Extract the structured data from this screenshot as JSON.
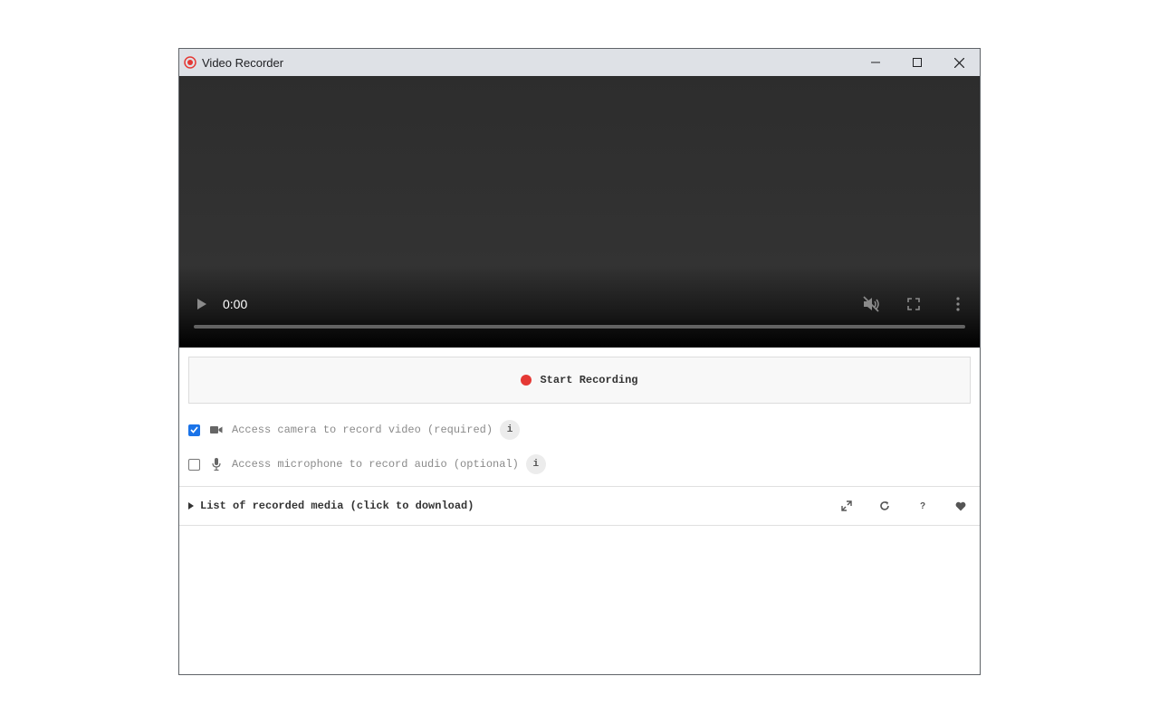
{
  "window": {
    "title": "Video Recorder",
    "controls": [
      "minimize",
      "maximize",
      "close"
    ]
  },
  "player": {
    "current_time": "0:00",
    "muted": true,
    "progress": 0
  },
  "recorder": {
    "start_label": "Start Recording",
    "record_color": "#e53935"
  },
  "options": {
    "camera": {
      "label": "Access camera to record video (required)",
      "checked": true,
      "info": "i",
      "icon": "video-camera-icon"
    },
    "microphone": {
      "label": "Access microphone to record audio (optional)",
      "checked": false,
      "info": "i",
      "icon": "microphone-icon"
    }
  },
  "media_list": {
    "label": "List of recorded media (click to download)",
    "tools": [
      "expand-icon",
      "refresh-icon",
      "help-icon",
      "heart-icon"
    ],
    "help_glyph": "?"
  },
  "colors": {
    "accent": "#1a73e8",
    "titlebar": "#dee1e6"
  }
}
